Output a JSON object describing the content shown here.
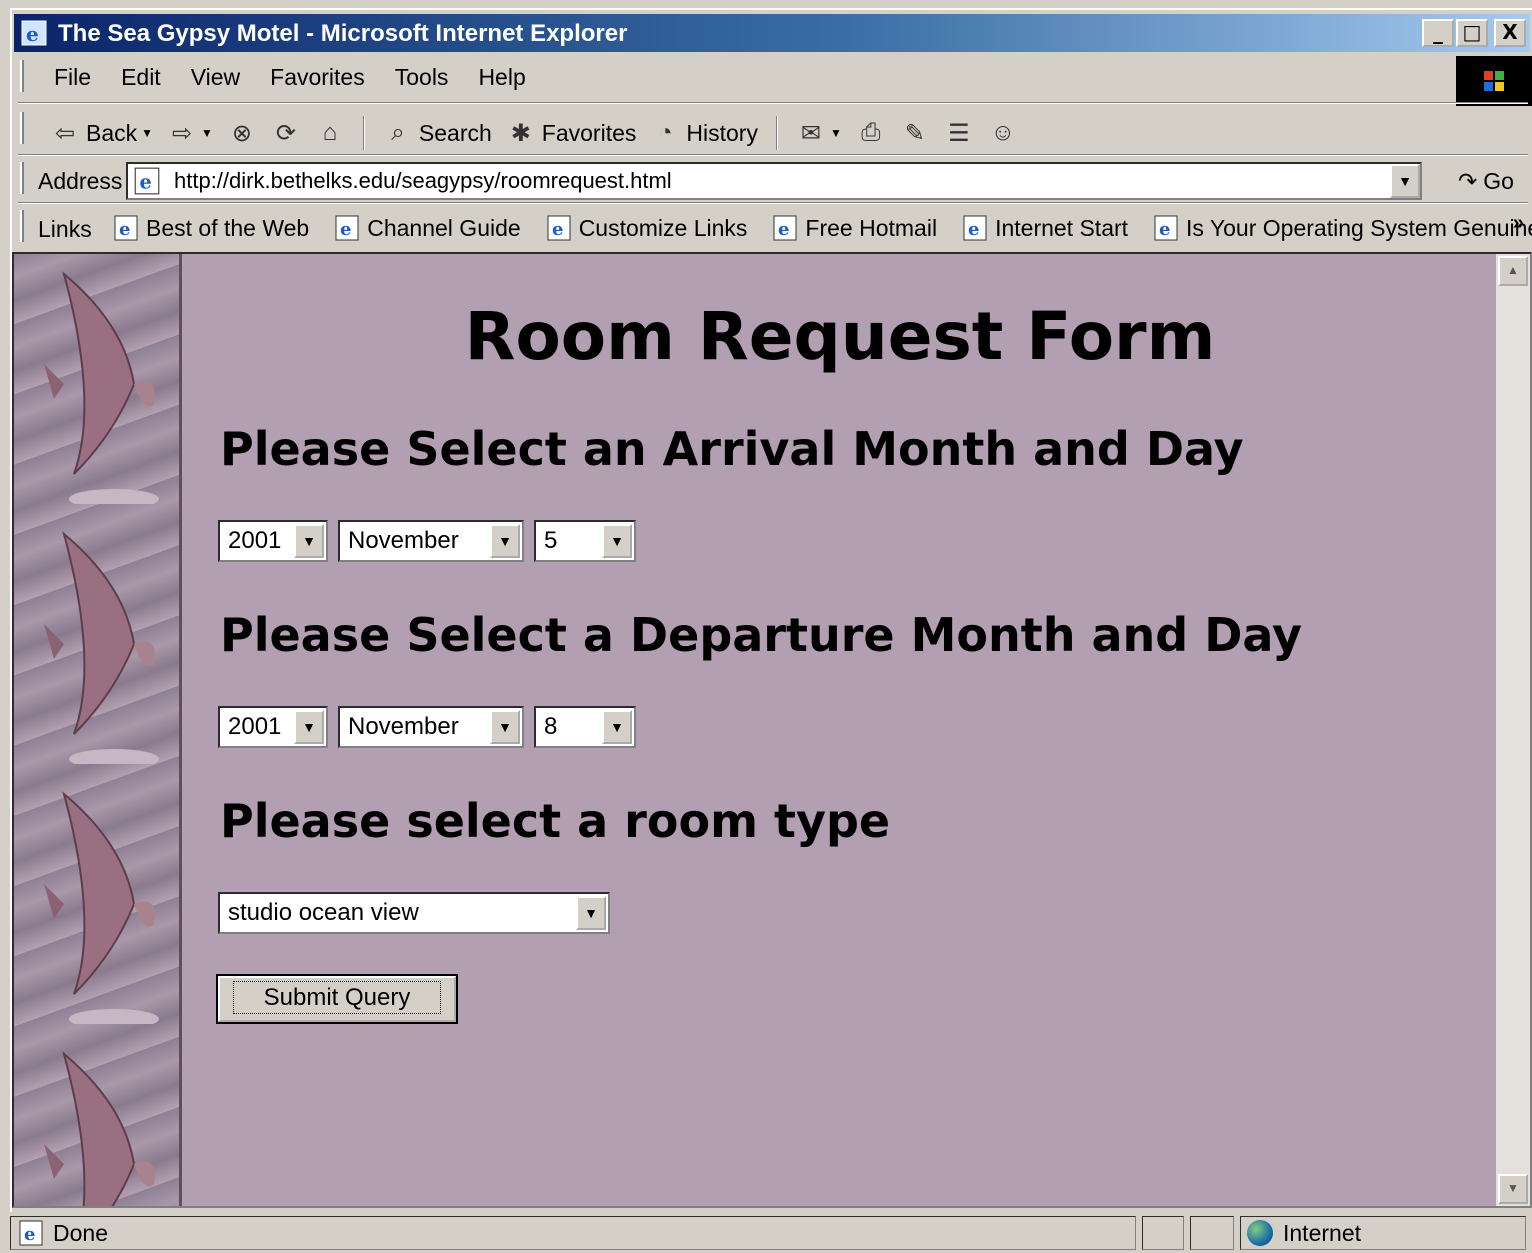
{
  "window": {
    "title": "The Sea Gypsy Motel - Microsoft Internet Explorer",
    "controls": {
      "minimize": "_",
      "maximize": "□",
      "close": "X"
    }
  },
  "menu": {
    "items": [
      "File",
      "Edit",
      "View",
      "Favorites",
      "Tools",
      "Help"
    ]
  },
  "toolbar": {
    "back_label": "Back",
    "search_label": "Search",
    "favorites_label": "Favorites",
    "history_label": "History"
  },
  "address": {
    "label": "Address",
    "url": "http://dirk.bethelks.edu/seagypsy/roomrequest.html",
    "go_label": "Go"
  },
  "links": {
    "label": "Links",
    "items": [
      "Best of the Web",
      "Channel Guide",
      "Customize Links",
      "Free Hotmail",
      "Internet Start",
      "Is Your Operating System Genuine"
    ],
    "more": "»"
  },
  "page": {
    "title": "Room Request Form",
    "arrival_heading": "Please Select an Arrival Month and Day",
    "arrival": {
      "year": "2001",
      "month": "November",
      "day": "5"
    },
    "departure_heading": "Please Select a Departure Month and Day",
    "departure": {
      "year": "2001",
      "month": "November",
      "day": "8"
    },
    "room_heading": "Please select a room type",
    "room_type": "studio ocean view",
    "submit_label": "Submit Query"
  },
  "status": {
    "text": "Done",
    "zone": "Internet"
  },
  "colors": {
    "page_background": "#b29fb1",
    "title_gradient_start": "#0a246a",
    "chrome": "#d4d0c8"
  }
}
